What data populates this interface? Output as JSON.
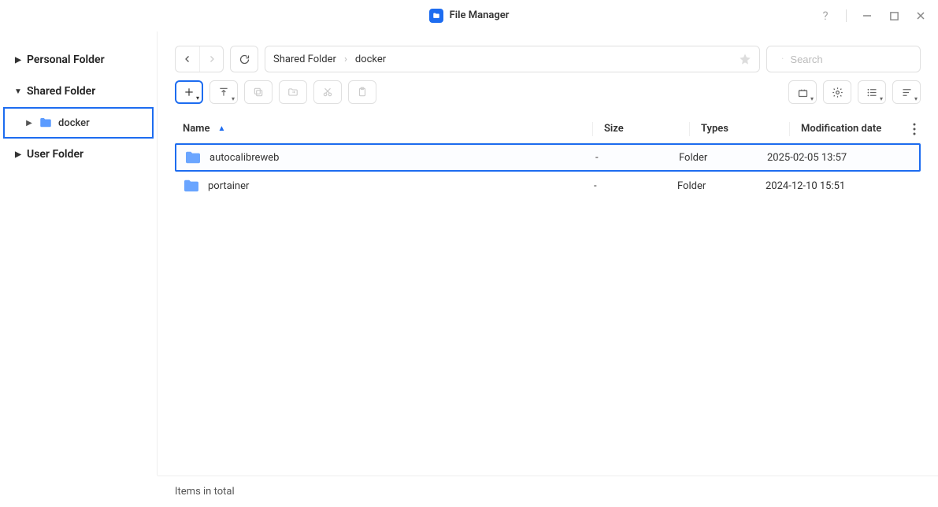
{
  "app": {
    "title": "File Manager"
  },
  "sidebar": {
    "items": [
      {
        "label": "Personal Folder",
        "expanded": false,
        "level": 1
      },
      {
        "label": "Shared Folder",
        "expanded": true,
        "level": 1
      },
      {
        "label": "docker",
        "expanded": false,
        "level": 2,
        "selected": true
      },
      {
        "label": "User Folder",
        "expanded": false,
        "level": 1
      }
    ]
  },
  "breadcrumb": {
    "parts": [
      "Shared Folder",
      "docker"
    ]
  },
  "search": {
    "placeholder": "Search"
  },
  "columns": {
    "name": "Name",
    "size": "Size",
    "types": "Types",
    "mod": "Modification date"
  },
  "rows": [
    {
      "name": "autocalibreweb",
      "size": "-",
      "types": "Folder",
      "mod": "2025-02-05 13:57",
      "selected": true
    },
    {
      "name": "portainer",
      "size": "-",
      "types": "Folder",
      "mod": "2024-12-10 15:51",
      "selected": false
    }
  ],
  "footer": {
    "status": "Items in total"
  }
}
